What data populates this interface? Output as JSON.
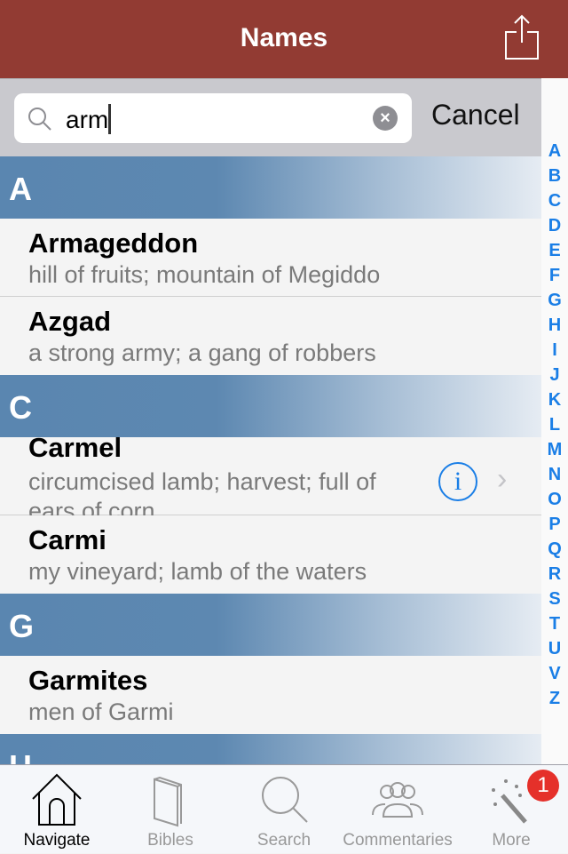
{
  "header": {
    "title": "Names",
    "share_icon": "share-icon"
  },
  "search": {
    "value": "arm",
    "cancel_label": "Cancel"
  },
  "sections": [
    {
      "letter": "A",
      "rows": [
        {
          "name": "Armageddon",
          "desc": "hill of fruits; mountain of Megiddo"
        },
        {
          "name": "Azgad",
          "desc": "a strong army; a gang of robbers"
        }
      ]
    },
    {
      "letter": "C",
      "rows": [
        {
          "name": "Carmel",
          "desc": "circumcised lamb; harvest; full of ears of corn"
        },
        {
          "name": "Carmi",
          "desc": "my vineyard; lamb of the waters"
        }
      ]
    },
    {
      "letter": "G",
      "rows": [
        {
          "name": "Garmites",
          "desc": "men of Garmi"
        }
      ]
    },
    {
      "letter": "H"
    }
  ],
  "index": [
    "A",
    "B",
    "C",
    "D",
    "E",
    "F",
    "G",
    "H",
    "I",
    "J",
    "K",
    "L",
    "M",
    "N",
    "O",
    "P",
    "Q",
    "R",
    "S",
    "T",
    "U",
    "V",
    "Z"
  ],
  "tabs": [
    {
      "label": "Navigate"
    },
    {
      "label": "Bibles"
    },
    {
      "label": "Search"
    },
    {
      "label": "Commentaries"
    },
    {
      "label": "More",
      "badge": "1"
    }
  ],
  "colors": {
    "nav": "#923b33",
    "accent": "#1a7ee6",
    "section": "#5a86b0",
    "badge": "#e5302a"
  }
}
